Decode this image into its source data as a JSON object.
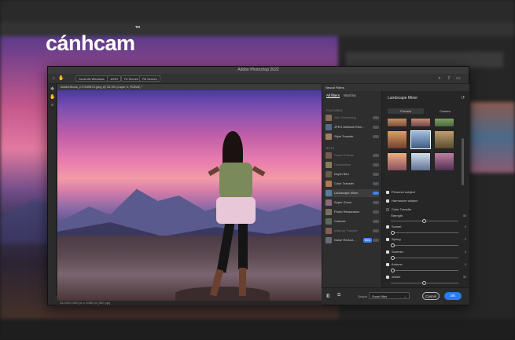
{
  "brand": {
    "name": "cánhcam",
    "mark": "™"
  },
  "background_app": {
    "title": "Adobe Photoshop 2022"
  },
  "window": {
    "title": "Adobe Photoshop 2022"
  },
  "toolbar": {
    "buttons": [
      "Scroll All Windows",
      "100%",
      "Fit Screen",
      "Fill Screen"
    ]
  },
  "document": {
    "tab": "AdobeStock_217549875.jpeg @ 33.3% (Layer 0, RGB/8) *",
    "status": "33.33%   1920 px x 1080 px (300 ppi)"
  },
  "neural_filters": {
    "panel_title": "Neural Filters",
    "tabs": [
      "All filters",
      "Wait list"
    ],
    "sections": [
      {
        "label": "FEATURED",
        "items": [
          {
            "name": "Skin Smoothing",
            "dim": true
          },
          {
            "name": "JPEG Artifacts Rem...",
            "dim": false
          },
          {
            "name": "Style Transfer",
            "dim": false
          }
        ]
      },
      {
        "label": "BETA",
        "items": [
          {
            "name": "Smart Portrait",
            "dim": true
          },
          {
            "name": "Colorization",
            "dim": true
          },
          {
            "name": "Depth Blur",
            "dim": false
          },
          {
            "name": "Color Transfer",
            "dim": false
          },
          {
            "name": "Landscape Mixer",
            "dim": false,
            "selected": true
          },
          {
            "name": "Super Zoom",
            "dim": false
          },
          {
            "name": "Photo Restoration",
            "dim": false
          },
          {
            "name": "Colorize",
            "dim": false
          },
          {
            "name": "Makeup Transfer",
            "dim": true
          },
          {
            "name": "Noise Reduct...",
            "dim": false,
            "badge": "New"
          }
        ]
      }
    ]
  },
  "detail": {
    "title": "Landscape Mixer",
    "tabs": [
      "Presets",
      "Custom"
    ],
    "options": [
      {
        "label": "Preserve subject",
        "checked": true
      },
      {
        "label": "Harmonize subject",
        "checked": true
      },
      {
        "label": "Color Transfer",
        "checked": false
      }
    ],
    "sliders": [
      {
        "label": "Strength",
        "value": "50",
        "checked": null,
        "fraction": 0.5
      },
      {
        "label": "Sunset",
        "value": "0",
        "checked": true,
        "fraction": 0.0
      },
      {
        "label": "Spring",
        "value": "0",
        "checked": true,
        "fraction": 0.0
      },
      {
        "label": "Summer",
        "value": "0",
        "checked": true,
        "fraction": 0.0
      },
      {
        "label": "Autumn",
        "value": "0",
        "checked": true,
        "fraction": 0.0
      },
      {
        "label": "Winter",
        "value": "50",
        "checked": true,
        "fraction": 0.5
      }
    ]
  },
  "footer": {
    "output_label": "Output",
    "output_value": "Smart filter",
    "cancel": "Cancel",
    "ok": "OK"
  },
  "colors": {
    "accent": "#2a7bf0"
  }
}
